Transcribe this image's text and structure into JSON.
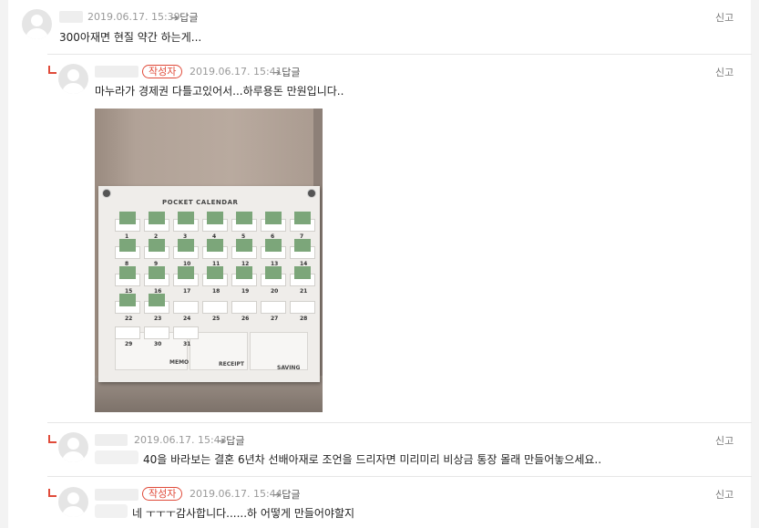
{
  "labels": {
    "reply": "답글",
    "report": "신고",
    "author_badge": "작성자"
  },
  "comments": [
    {
      "timestamp": "2019.06.17. 15:39",
      "text": "300아재면 현질 약간 하는게..."
    },
    {
      "timestamp": "2019.06.17. 15:41",
      "text": "마누라가 경제권 다틀고있어서...하루용돈 만원입니다.."
    },
    {
      "timestamp": "2019.06.17. 15:43",
      "text": "40을 바라보는 결혼 6년차 선배아재로 조언을 드리자면 미리미리 비상금 통장 몰래 만들어놓으세요.."
    },
    {
      "timestamp": "2019.06.17. 15:44",
      "text": "네 ㅜㅜㅜ감사합니다......하 어떻게 만들어야할지"
    }
  ],
  "photo": {
    "title": "POCKET CALENDAR",
    "days": [
      "1",
      "2",
      "3",
      "4",
      "5",
      "6",
      "7",
      "8",
      "9",
      "10",
      "11",
      "12",
      "13",
      "14",
      "15",
      "16",
      "17",
      "18",
      "19",
      "20",
      "21",
      "22",
      "23",
      "24",
      "25",
      "26",
      "27",
      "28",
      "29",
      "30",
      "31"
    ],
    "bottom_labels": [
      "MEMO",
      "RECEIPT",
      "SAVING"
    ]
  }
}
